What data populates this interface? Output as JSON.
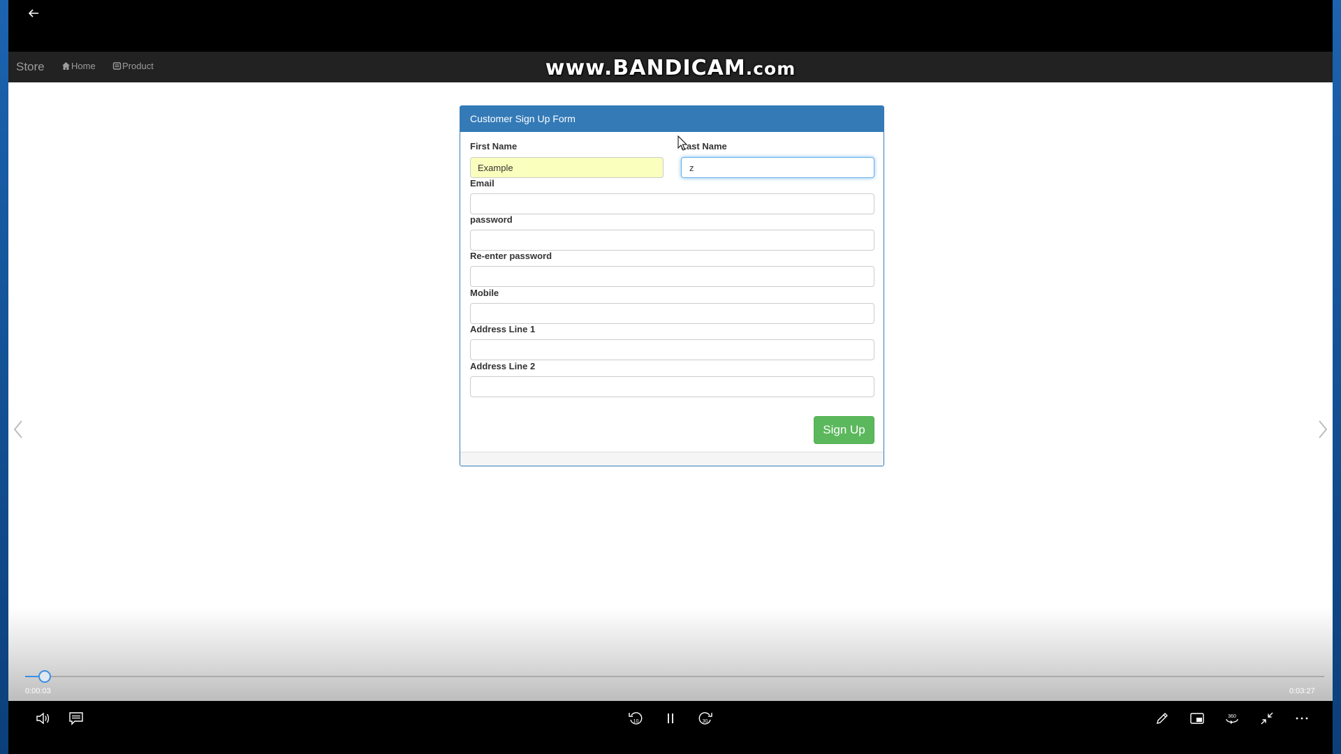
{
  "player": {
    "seek": {
      "progress": 0.015,
      "current_time": "0:00:03",
      "total_time": "0:03:27"
    }
  },
  "navbar": {
    "brand": "Store",
    "home": "Home",
    "product": "Product"
  },
  "watermark": {
    "main": "www.BANDICAM",
    "domain": ".com"
  },
  "form": {
    "title": "Customer Sign Up Form",
    "first_name_label": "First Name",
    "first_name_value": "Example",
    "last_name_label": "Last Name",
    "last_name_value": "z",
    "email_label": "Email",
    "email_value": "",
    "password_label": "password",
    "password_value": "",
    "repassword_label": "Re-enter password",
    "repassword_value": "",
    "mobile_label": "Mobile",
    "mobile_value": "",
    "address1_label": "Address Line 1",
    "address1_value": "",
    "address2_label": "Address Line 2",
    "address2_value": "",
    "submit_label": "Sign Up"
  },
  "controls": {
    "rewind_label": "10",
    "forward_label": "30",
    "view360_label": "360"
  },
  "colors": {
    "panel_primary": "#337ab7",
    "success": "#5cb85c",
    "autofill": "#faffbd",
    "seek_accent": "#3e8ee0"
  },
  "icons": [
    "back-arrow-icon",
    "home-icon",
    "product-icon",
    "chevron-left-icon",
    "chevron-right-icon",
    "volume-icon",
    "subtitles-icon",
    "rewind-icon",
    "pause-icon",
    "forward-icon",
    "pen-icon",
    "miniview-icon",
    "view360-icon",
    "exit-fullscreen-icon",
    "more-icon"
  ]
}
